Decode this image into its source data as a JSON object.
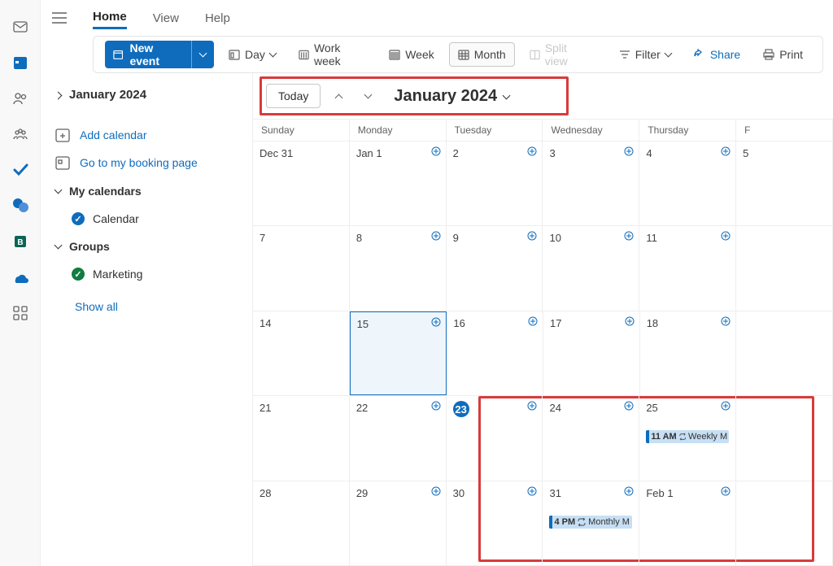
{
  "tabs": {
    "home": "Home",
    "view": "View",
    "help": "Help"
  },
  "cmd": {
    "newEvent": "New event",
    "day": "Day",
    "workWeek": "Work week",
    "week": "Week",
    "month": "Month",
    "splitView": "Split view",
    "filter": "Filter",
    "share": "Share",
    "print": "Print"
  },
  "side": {
    "month": "January 2024",
    "addCalendar": "Add calendar",
    "booking": "Go to my booking page",
    "myCalendars": "My calendars",
    "calendar": "Calendar",
    "groups": "Groups",
    "marketing": "Marketing",
    "showAll": "Show all"
  },
  "calHeader": {
    "today": "Today",
    "title": "January 2024"
  },
  "dayNames": [
    "Sunday",
    "Monday",
    "Tuesday",
    "Wednesday",
    "Thursday",
    "F"
  ],
  "weeks": [
    [
      {
        "n": "Dec 31",
        "add": false
      },
      {
        "n": "Jan 1",
        "add": true
      },
      {
        "n": "2",
        "add": true
      },
      {
        "n": "3",
        "add": true
      },
      {
        "n": "4",
        "add": true
      },
      {
        "n": "5",
        "add": false
      }
    ],
    [
      {
        "n": "7",
        "add": false
      },
      {
        "n": "8",
        "add": true
      },
      {
        "n": "9",
        "add": true
      },
      {
        "n": "10",
        "add": true
      },
      {
        "n": "11",
        "add": true
      },
      {
        "n": "",
        "add": false
      }
    ],
    [
      {
        "n": "14",
        "add": false
      },
      {
        "n": "15",
        "add": true,
        "sel": true
      },
      {
        "n": "16",
        "add": true
      },
      {
        "n": "17",
        "add": true
      },
      {
        "n": "18",
        "add": true
      },
      {
        "n": "",
        "add": false
      }
    ],
    [
      {
        "n": "21",
        "add": false
      },
      {
        "n": "22",
        "add": true
      },
      {
        "n": "23",
        "add": true,
        "today": true
      },
      {
        "n": "24",
        "add": true
      },
      {
        "n": "25",
        "add": true,
        "evt": {
          "t": "11 AM",
          "txt": "Weekly M"
        }
      },
      {
        "n": "",
        "add": false
      }
    ],
    [
      {
        "n": "28",
        "add": false
      },
      {
        "n": "29",
        "add": true
      },
      {
        "n": "30",
        "add": true
      },
      {
        "n": "31",
        "add": true,
        "evt": {
          "t": "4 PM",
          "txt": "Monthly M"
        }
      },
      {
        "n": "Feb 1",
        "add": true
      },
      {
        "n": "",
        "add": false
      }
    ]
  ]
}
